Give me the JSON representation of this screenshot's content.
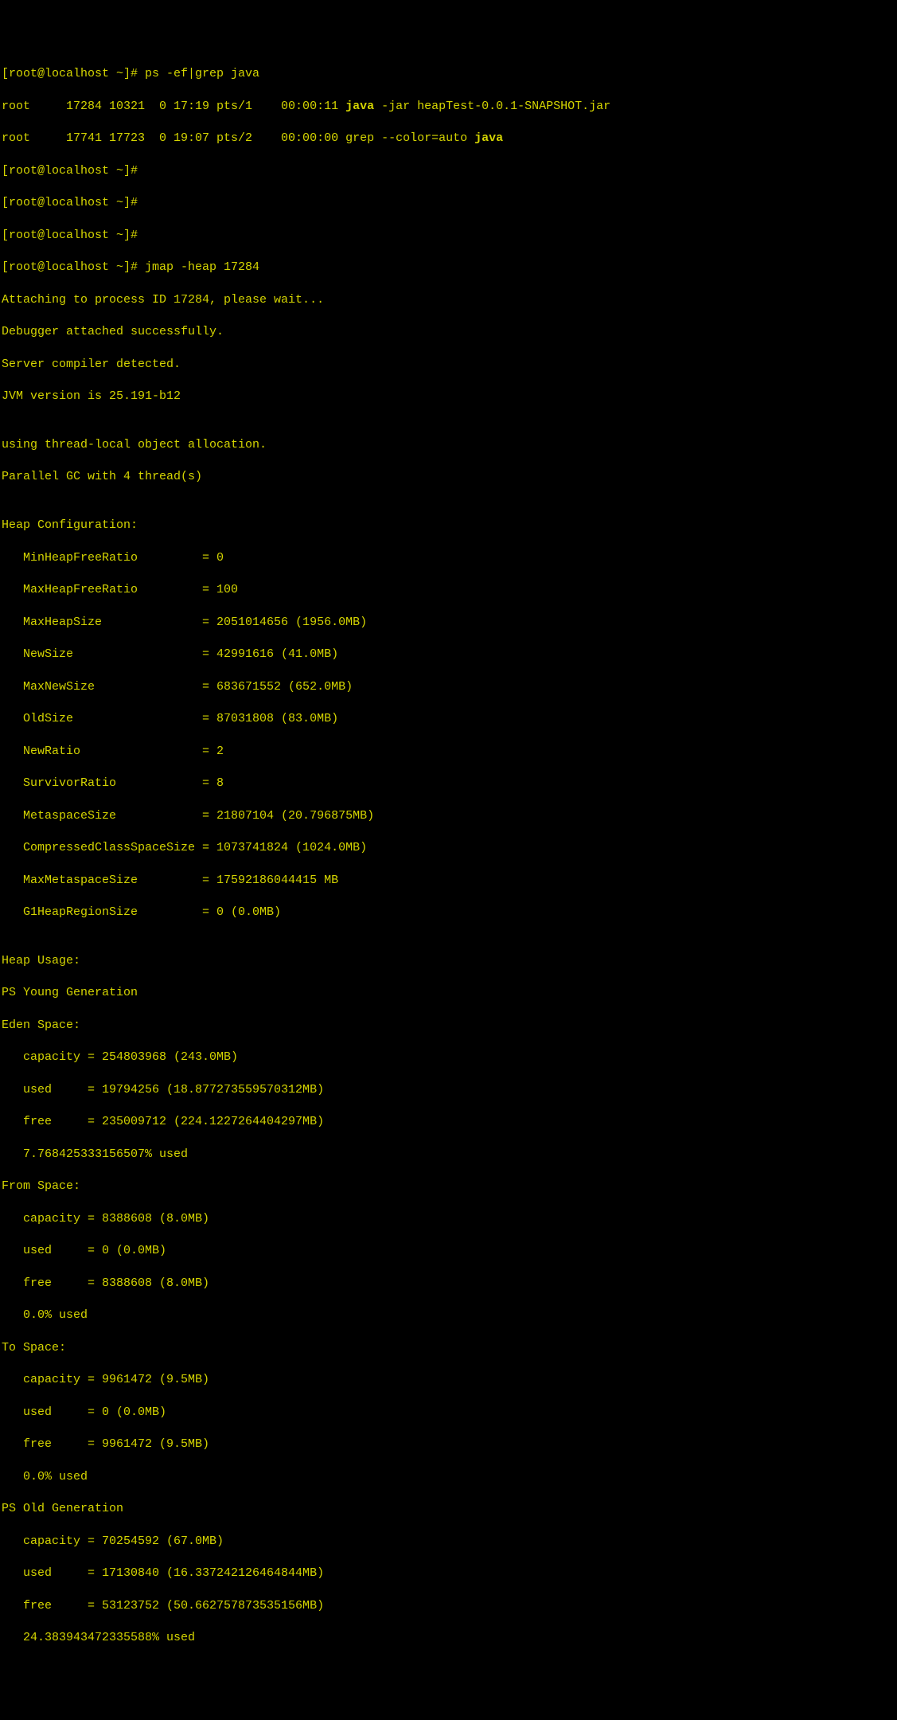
{
  "lines": {
    "l01": "[root@localhost ~]# ps -ef|grep java",
    "l02a": "root     17284 10321  0 17:19 pts/1    00:00:11 ",
    "l02b": "java",
    "l02c": " -jar heapTest-0.0.1-SNAPSHOT.jar",
    "l03a": "root     17741 17723  0 19:07 pts/2    00:00:00 grep --color=auto ",
    "l03b": "java",
    "l04": "[root@localhost ~]#",
    "l05": "[root@localhost ~]#",
    "l06": "[root@localhost ~]#",
    "l07": "[root@localhost ~]# jmap -heap 17284",
    "l08": "Attaching to process ID 17284, please wait...",
    "l09": "Debugger attached successfully.",
    "l10": "Server compiler detected.",
    "l11": "JVM version is 25.191-b12",
    "l12": "",
    "l13": "using thread-local object allocation.",
    "l14": "Parallel GC with 4 thread(s)",
    "l15": "",
    "l16": "Heap Configuration:",
    "l17": "   MinHeapFreeRatio         = 0",
    "l18": "   MaxHeapFreeRatio         = 100",
    "l19": "   MaxHeapSize              = 2051014656 (1956.0MB)",
    "l20": "   NewSize                  = 42991616 (41.0MB)",
    "l21": "   MaxNewSize               = 683671552 (652.0MB)",
    "l22": "   OldSize                  = 87031808 (83.0MB)",
    "l23": "   NewRatio                 = 2",
    "l24": "   SurvivorRatio            = 8",
    "l25": "   MetaspaceSize            = 21807104 (20.796875MB)",
    "l26": "   CompressedClassSpaceSize = 1073741824 (1024.0MB)",
    "l27": "   MaxMetaspaceSize         = 17592186044415 MB",
    "l28": "   G1HeapRegionSize         = 0 (0.0MB)",
    "l29": "",
    "l30": "Heap Usage:",
    "l31": "PS Young Generation",
    "l32": "Eden Space:",
    "l33": "   capacity = 254803968 (243.0MB)",
    "l34": "   used     = 19794256 (18.877273559570312MB)",
    "l35": "   free     = 235009712 (224.1227264404297MB)",
    "l36": "   7.768425333156507% used",
    "l37": "From Space:",
    "l38": "   capacity = 8388608 (8.0MB)",
    "l39": "   used     = 0 (0.0MB)",
    "l40": "   free     = 8388608 (8.0MB)",
    "l41": "   0.0% used",
    "l42": "To Space:",
    "l43": "   capacity = 9961472 (9.5MB)",
    "l44": "   used     = 0 (0.0MB)",
    "l45": "   free     = 9961472 (9.5MB)",
    "l46": "   0.0% used",
    "l47": "PS Old Generation",
    "l48": "   capacity = 70254592 (67.0MB)",
    "l49": "   used     = 17130840 (16.337242126464844MB)",
    "l50": "   free     = 53123752 (50.662757873535156MB)",
    "l51": "   24.383943472335588% used"
  }
}
